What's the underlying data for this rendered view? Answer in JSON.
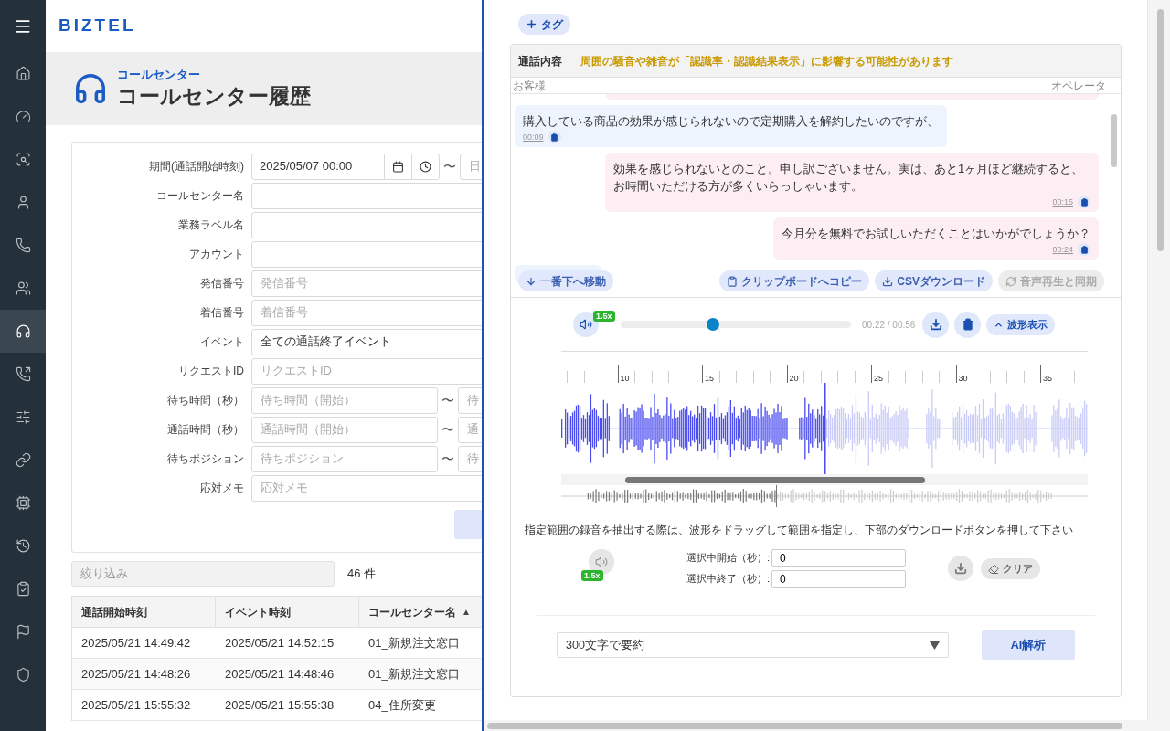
{
  "sidebar": {
    "items": [
      {
        "kind": "home",
        "selected": false
      },
      {
        "kind": "gauge",
        "selected": false
      },
      {
        "kind": "voice-search",
        "selected": false
      },
      {
        "kind": "user",
        "selected": false
      },
      {
        "kind": "phone",
        "selected": false
      },
      {
        "kind": "users",
        "selected": false
      },
      {
        "kind": "headset",
        "selected": true
      },
      {
        "kind": "phone-out",
        "selected": false
      },
      {
        "kind": "sliders",
        "selected": false
      },
      {
        "kind": "link",
        "selected": false
      },
      {
        "kind": "chip",
        "selected": false
      },
      {
        "kind": "history",
        "selected": false
      },
      {
        "kind": "checklist",
        "selected": false
      },
      {
        "kind": "flag",
        "selected": false
      },
      {
        "kind": "shield",
        "selected": false
      }
    ]
  },
  "header": {
    "logo": "BIZTEL"
  },
  "title": {
    "breadcrumb": "コールセンター",
    "heading": "コールセンター履歴"
  },
  "form": {
    "rows": [
      {
        "label": "期間(通話開始時刻)",
        "kind": "datetime",
        "value": "2025/05/07 00:00",
        "separator": "〜",
        "end_placeholder": "日"
      },
      {
        "label": "コールセンター名",
        "kind": "input"
      },
      {
        "label": "業務ラベル名",
        "kind": "input"
      },
      {
        "label": "アカウント",
        "kind": "input"
      },
      {
        "label": "発信番号",
        "kind": "input",
        "placeholder": "発信番号"
      },
      {
        "label": "着信番号",
        "kind": "input",
        "placeholder": "着信番号"
      },
      {
        "label": "イベント",
        "kind": "input",
        "value": "全ての通話終了イベント"
      },
      {
        "label": "リクエストID",
        "kind": "input",
        "placeholder": "リクエストID"
      },
      {
        "label": "待ち時間（秒）",
        "kind": "range",
        "placeholder": "待ち時間（開始）",
        "separator": "〜",
        "end_placeholder": "待"
      },
      {
        "label": "通話時間（秒）",
        "kind": "range",
        "placeholder": "通話時間（開始）",
        "separator": "〜",
        "end_placeholder": "通"
      },
      {
        "label": "待ちポジション",
        "kind": "range",
        "placeholder": "待ちポジション",
        "separator": "〜",
        "end_placeholder": "待"
      },
      {
        "label": "応対メモ",
        "kind": "input",
        "placeholder": "応対メモ"
      }
    ]
  },
  "filter": {
    "placeholder": "絞り込み",
    "count": "46 件"
  },
  "table": {
    "columns": [
      {
        "label": "通話開始時刻"
      },
      {
        "label": "イベント時刻"
      },
      {
        "label": "コールセンター名",
        "sort_mark": "▲"
      }
    ],
    "rows": [
      [
        "2025/05/21 14:49:42",
        "2025/05/21 14:52:15",
        "01_新規注文窓口"
      ],
      [
        "2025/05/21 14:48:26",
        "2025/05/21 14:48:46",
        "01_新規注文窓口"
      ],
      [
        "2025/05/21 15:55:32",
        "2025/05/21 15:55:38",
        "04_住所変更"
      ]
    ]
  },
  "tag_button": "タグ",
  "transcript": {
    "title": "通話内容",
    "notice": "周囲の騒音や雑音が「認識率・認識結果表示」に影響する可能性があります",
    "left_speaker": "お客様",
    "right_speaker": "オペレータ",
    "messages": [
      {
        "from_operator": false,
        "text": "購入している商品の効果が感じられないので定期購入を解約したいのですが、",
        "time": "00:09"
      },
      {
        "from_operator": true,
        "text": "効果を感じられないとのこと。申し訳ございません。実は、あと1ヶ月ほど継続すると、お時間いただける方が多くいらっしゃいます。",
        "time": "00:15"
      },
      {
        "from_operator": true,
        "text": "今月分を無料でお試しいただくことはいかがでしょうか？",
        "time": "00:24"
      }
    ],
    "actions": [
      {
        "kind": "scroll",
        "label": "一番下へ移動",
        "disabled": false
      },
      {
        "kind": "copy",
        "label": "クリップボードへコピー",
        "disabled": false
      },
      {
        "kind": "csv",
        "label": "CSVダウンロード",
        "disabled": false
      },
      {
        "kind": "sync",
        "label": "音声再生と同期",
        "disabled": true
      }
    ]
  },
  "player": {
    "speed": "1.5x",
    "level": 0.4,
    "time": "00:22 / 00:56",
    "waveform_toggle": "波形表示",
    "ticks": [
      "10",
      "15",
      "20",
      "25",
      "30",
      "35"
    ],
    "note": "指定範囲の録音を抽出する際は、波形をドラッグして範囲を指定し、下部のダウンロードボタンを押して下さい",
    "selection": {
      "speed": "1.5x",
      "start_label": "選択中開始（秒）:",
      "start_value": "0",
      "end_label": "選択中終了（秒）:",
      "end_value": "0",
      "clear": "クリア"
    }
  },
  "summary": {
    "value": "300文字で要約",
    "analyze": "AI解析"
  }
}
